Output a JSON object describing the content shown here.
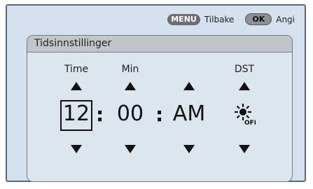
{
  "hints": {
    "menu_key": "MENU",
    "menu_label": "Tilbake",
    "ok_key": "OK",
    "ok_label": "Angi"
  },
  "panel": {
    "title": "Tidsinnstillinger"
  },
  "fields": {
    "hour_label": "Time",
    "minute_label": "Min",
    "dst_label": "DST",
    "hour_value": "12",
    "minute_value": "00",
    "ampm_value": "AM",
    "separator": ":",
    "dst_value": "OFF"
  },
  "colors": {
    "background": "#d4e2f0",
    "panel": "#dde6ef",
    "title_bar": "#c2c5c9"
  }
}
